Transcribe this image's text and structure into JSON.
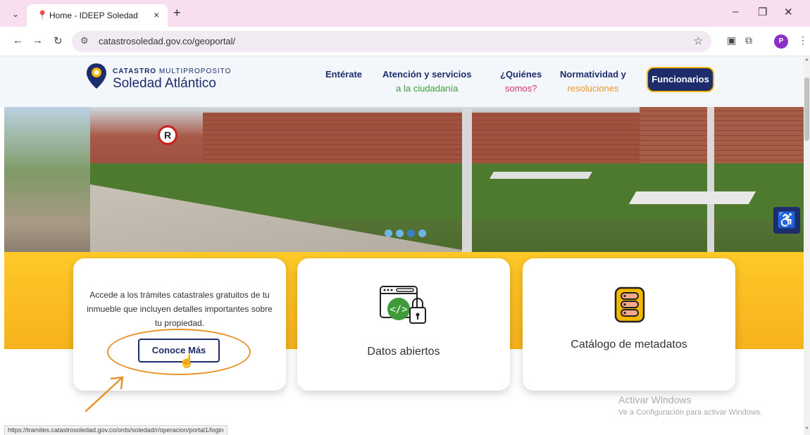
{
  "browser": {
    "tab_title": "Home - IDEEP Soledad",
    "url": "catastrosoledad.gov.co/geoportal/",
    "profile_initial": "P",
    "status_url": "https://tramites.catastrosoledad.gov.co/ords/soledad/r/operacion/portal1/login"
  },
  "header": {
    "logo_bold": "CATASTRO",
    "logo_light": " MULTIPROPOSITO",
    "logo_main": "Soledad Atlántico",
    "menu": [
      {
        "line1": "Entérate",
        "line2": ""
      },
      {
        "line1": "Atención y servicios",
        "line2": "a la ciudadanía"
      },
      {
        "line1": "¿Quiénes",
        "line2": "somos?"
      },
      {
        "line1": "Normatividad y",
        "line2": "resoluciones"
      }
    ],
    "funcionarios_label": "Funcionarios"
  },
  "hero": {
    "sign_letter": "R"
  },
  "cards": {
    "tramites_text": "Accede a los trámites catastrales gratuitos de tu inmueble que incluyen detalles importantes sobre tu propiedad.",
    "conoce_label": "Conoce Más",
    "datos_label": "Datos abiertos",
    "catalogo_label": "Catálogo de metadatos"
  },
  "watermark": {
    "title": "Activar Windows",
    "subtitle": "Ve a Configuración para activar Windows."
  },
  "colors": {
    "brand_navy": "#1d2d6b",
    "brand_yellow": "#f5b800",
    "accent_green": "#3f9b3a",
    "accent_pink": "#d6336c",
    "accent_orange": "#e9962b"
  },
  "icons": {
    "tab_menu": "chevron-down-icon",
    "favicon": "location-pin-icon",
    "accessibility": "accessibility-icon",
    "datos": "code-window-lock-icon",
    "catalogo": "metadata-catalog-icon"
  }
}
